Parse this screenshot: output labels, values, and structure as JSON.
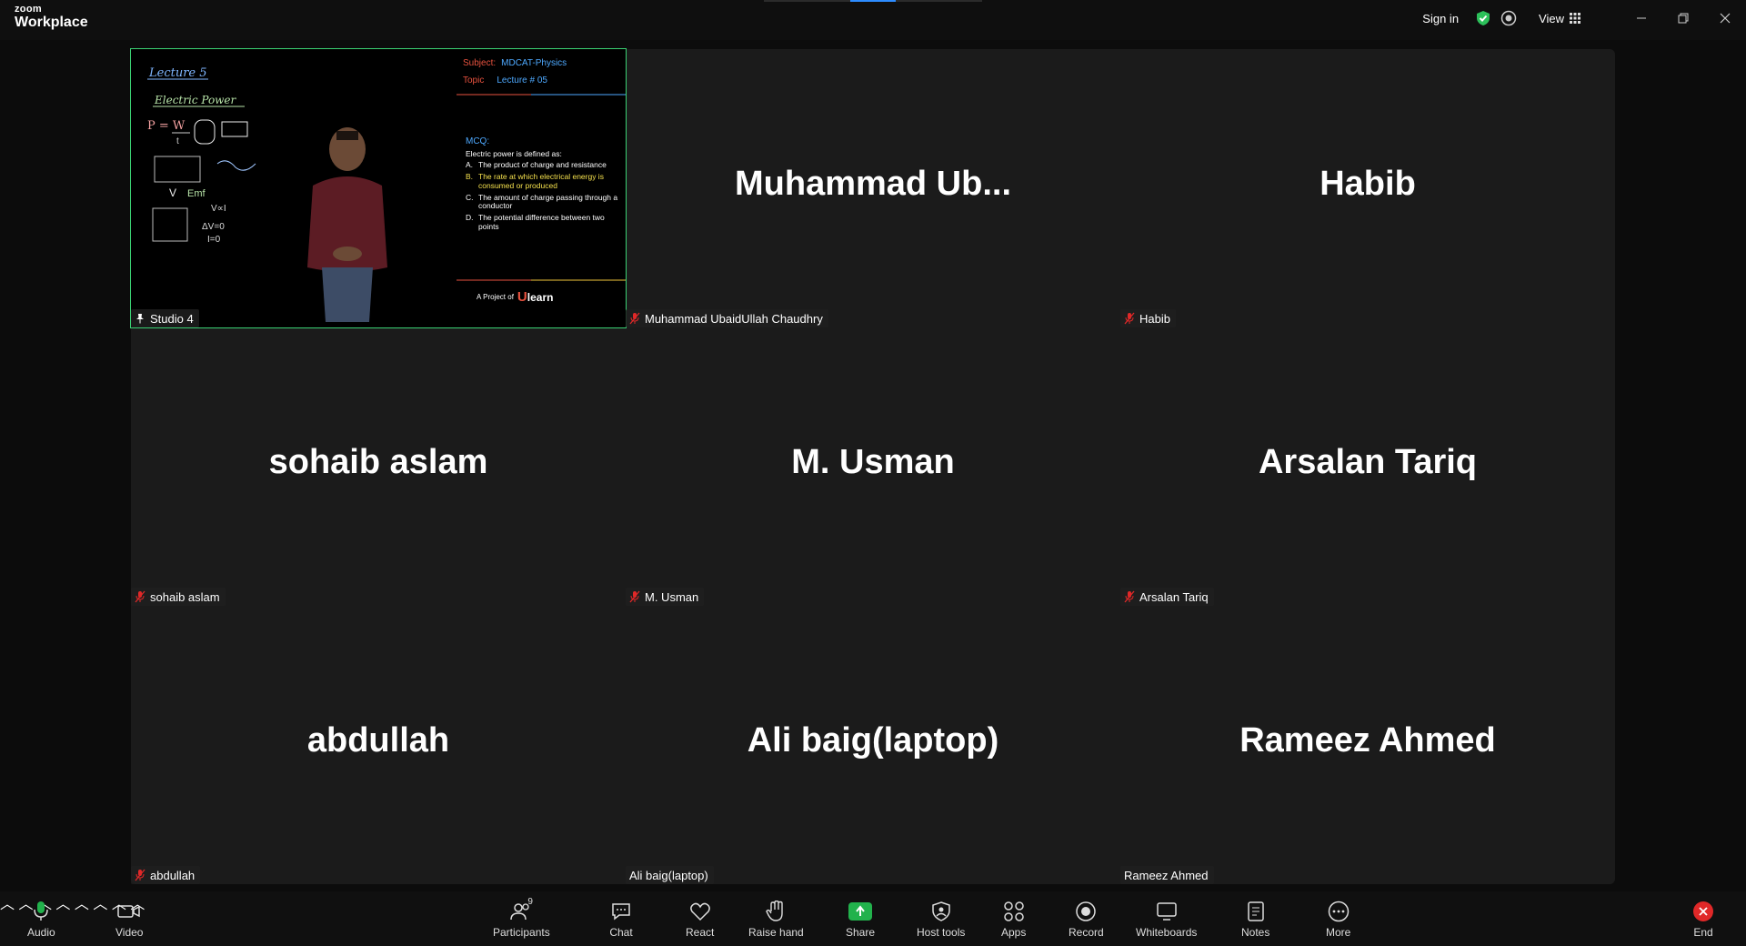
{
  "app": {
    "brand_small": "zoom",
    "brand_large": "Workplace"
  },
  "topbar": {
    "signin": "Sign in",
    "view": "View"
  },
  "tiles": [
    {
      "big": "",
      "tag": "Studio 4"
    },
    {
      "big": "Muhammad  Ub...",
      "tag": "Muhammad UbaidUllah Chaudhry"
    },
    {
      "big": "Habib",
      "tag": "Habib"
    },
    {
      "big": "sohaib aslam",
      "tag": "sohaib aslam"
    },
    {
      "big": "M. Usman",
      "tag": "M. Usman"
    },
    {
      "big": "Arsalan Tariq",
      "tag": "Arsalan Tariq"
    },
    {
      "big": "abdullah",
      "tag": "abdullah"
    },
    {
      "big": "Ali baig(laptop)",
      "tag": "Ali baig(laptop)"
    },
    {
      "big": "Rameez Ahmed",
      "tag": "Rameez Ahmed"
    }
  ],
  "slide": {
    "subject_label": "Subject:",
    "subject_value": "MDCAT-Physics",
    "topic_label": "Topic",
    "topic_value": "Lecture # 05",
    "mcq_head": "MCQ:",
    "question": "Electric power is defined as:",
    "options": [
      {
        "letter": "A.",
        "text": "The product of charge and resistance"
      },
      {
        "letter": "B.",
        "text": "The rate at which electrical energy is consumed or produced"
      },
      {
        "letter": "C.",
        "text": "The amount of charge passing through a conductor"
      },
      {
        "letter": "D.",
        "text": "The potential difference between two points"
      }
    ],
    "credit_prefix": "A Project of",
    "credit_logo": "learn",
    "credit_logo_u": "U",
    "board_title": "Lecture 5",
    "board_subtitle": "Electric Power"
  },
  "toolbar": {
    "audio": "Audio",
    "video": "Video",
    "participants": "Participants",
    "participants_count": "9",
    "chat": "Chat",
    "react": "React",
    "raise_hand": "Raise hand",
    "share": "Share",
    "host_tools": "Host tools",
    "apps": "Apps",
    "record": "Record",
    "whiteboards": "Whiteboards",
    "notes": "Notes",
    "more": "More",
    "end": "End"
  },
  "colors": {
    "active_speaker": "#3ad073",
    "share_green": "#22b24c",
    "end_red": "#e02828",
    "muted_red": "#e02828"
  }
}
